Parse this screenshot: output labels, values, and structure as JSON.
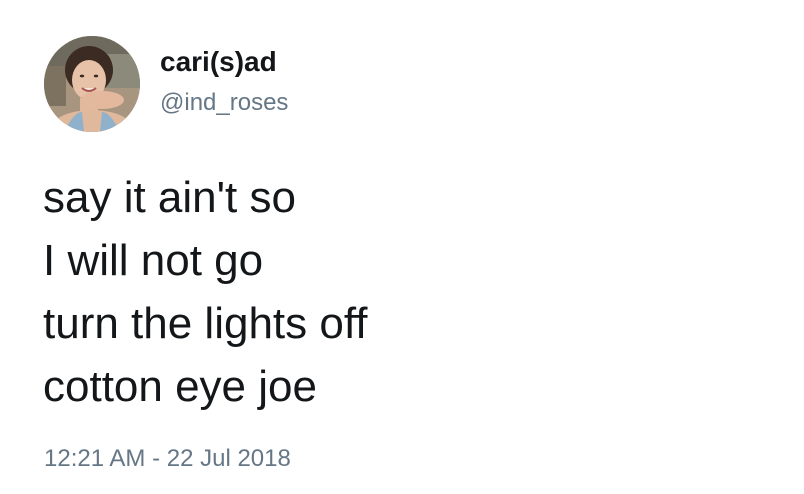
{
  "author": {
    "display_name": "cari(s)ad",
    "handle": "@ind_roses"
  },
  "tweet": {
    "lines": [
      "say it ain't so",
      "I will not go",
      "turn the lights off",
      "cotton eye joe"
    ],
    "timestamp": "12:21 AM - 22 Jul 2018"
  },
  "colors": {
    "text": "#14171a",
    "secondary": "#657786",
    "background": "#ffffff"
  }
}
